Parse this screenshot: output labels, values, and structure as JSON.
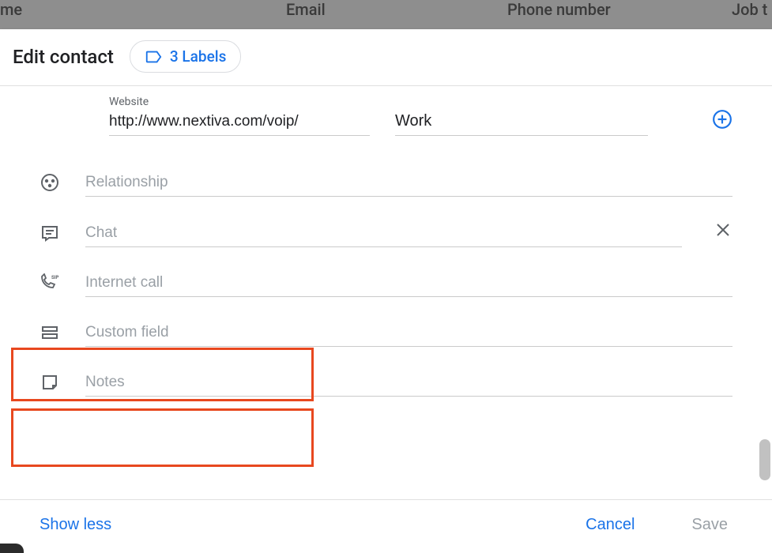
{
  "backdrop_columns": {
    "name": "me",
    "email": "Email",
    "phone": "Phone number",
    "job": "Job t"
  },
  "dialog": {
    "title": "Edit contact",
    "labels_chip": "3 Labels"
  },
  "website": {
    "label": "Website",
    "value": "http://www.nextiva.com/voip/",
    "type_value": "Work"
  },
  "fields": {
    "relationship_placeholder": "Relationship",
    "chat_placeholder": "Chat",
    "internet_call_placeholder": "Internet call",
    "custom_field_placeholder": "Custom field",
    "notes_placeholder": "Notes"
  },
  "footer": {
    "show_less": "Show less",
    "cancel": "Cancel",
    "save": "Save"
  }
}
